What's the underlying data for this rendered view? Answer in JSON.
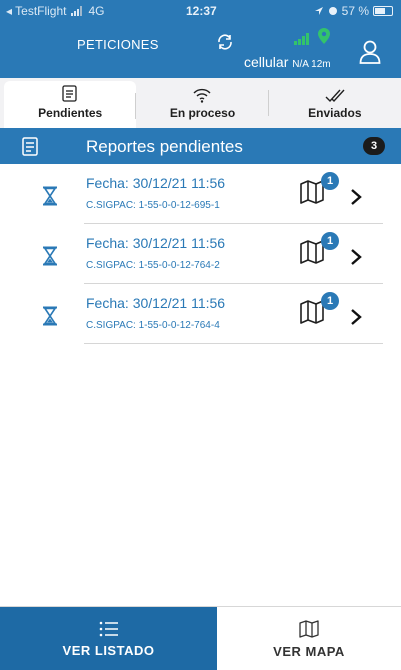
{
  "status_bar": {
    "carrier": "◂ TestFlight",
    "network": "4G",
    "time": "12:37",
    "battery": "57 %"
  },
  "header": {
    "title": "PETICIONES",
    "connection": "cellular",
    "connection_detail": "N/A 12m"
  },
  "tabs": [
    {
      "label": "Pendientes",
      "icon": "document-list-icon",
      "active": true
    },
    {
      "label": "En proceso",
      "icon": "wifi-icon",
      "active": false
    },
    {
      "label": "Enviados",
      "icon": "double-check-icon",
      "active": false
    }
  ],
  "section": {
    "title": "Reportes pendientes",
    "count": "3"
  },
  "items": [
    {
      "date": "Fecha: 30/12/21 11:56",
      "code": "C.SIGPAC: 1-55-0-0-12-695-1",
      "map_count": "1"
    },
    {
      "date": "Fecha: 30/12/21 11:56",
      "code": "C.SIGPAC: 1-55-0-0-12-764-2",
      "map_count": "1"
    },
    {
      "date": "Fecha: 30/12/21 11:56",
      "code": "C.SIGPAC: 1-55-0-0-12-764-4",
      "map_count": "1"
    }
  ],
  "bottom_nav": {
    "list_label": "VER LISTADO",
    "map_label": "VER MAPA"
  },
  "colors": {
    "primary": "#2a79b6",
    "primary_dark": "#1e6aa5",
    "signal_green": "#33c36b"
  }
}
